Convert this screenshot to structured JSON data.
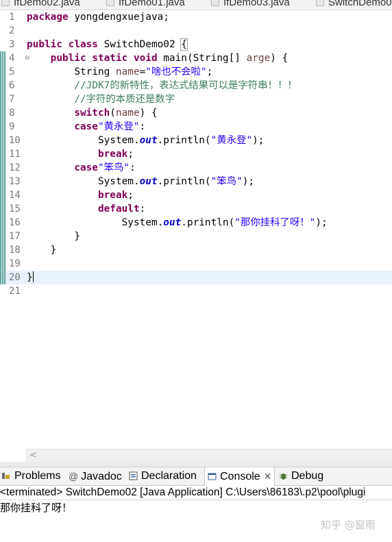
{
  "editor_tabs": [
    "IfDemo02.java",
    "IfDemo01.java",
    "IfDemo03.java",
    "SwitchDemo0"
  ],
  "code": {
    "line_numbers": [
      "1",
      "2",
      "3",
      "4",
      "5",
      "6",
      "7",
      "8",
      "9",
      "10",
      "11",
      "12",
      "13",
      "14",
      "15",
      "16",
      "17",
      "18",
      "19",
      "20",
      "21"
    ],
    "l1": {
      "kw": "package",
      "rest": " yongdengxuejava;"
    },
    "l3": {
      "kw1": "public",
      "kw2": "class",
      "name": " SwitchDemo02 ",
      "brace": "{"
    },
    "l4": {
      "kw1": "public",
      "kw2": "static",
      "kw3": "void",
      "sig1": " main(String[] ",
      "param": "arge",
      "sig2": ") {"
    },
    "l5": {
      "type": "String ",
      "var": "name",
      "eq": "=",
      "str": "\"啥也不会啦\"",
      "end": ";"
    },
    "l6": "//JDK7的新特性，表达式结果可以是字符串！！！",
    "l7": "//字符的本质还是数字",
    "l8": {
      "kw": "switch",
      "open": "(",
      "var": "name",
      "close": ") {"
    },
    "l9": {
      "kw": "case",
      "str": "\"黄永登\"",
      "end": ":"
    },
    "l10": {
      "pre": "System.",
      "fld": "out",
      "mid": ".println(",
      "str": "\"黄永登\"",
      "end": ");"
    },
    "l11": {
      "kw": "break",
      "end": ";"
    },
    "l12": {
      "kw": "case",
      "str": "\"笨鸟\"",
      "end": ":"
    },
    "l13": {
      "pre": "System.",
      "fld": "out",
      "mid": ".println(",
      "str": "\"笨鸟\"",
      "end": ");"
    },
    "l14": {
      "kw": "break",
      "end": ";"
    },
    "l15": {
      "kw": "default",
      "end": ":"
    },
    "l16": {
      "pre": "System.",
      "fld": "out",
      "mid": ".println(",
      "str": "\"那你挂科了呀！\"",
      "end": ");"
    },
    "l17": "}",
    "l18": "}",
    "l20": "}"
  },
  "views": {
    "problems": "Problems",
    "javadoc": "Javadoc",
    "declaration": "Declaration",
    "console": "Console",
    "debug": "Debug"
  },
  "console": {
    "status": "<terminated> SwitchDemo02 [Java Application] C:\\Users\\86183\\.p2\\pool\\plugi",
    "output": "那你挂科了呀！"
  },
  "watermark": "知乎 @窗雨",
  "colors": {
    "keyword": "#7f0055",
    "string": "#2a00ff",
    "comment": "#3f7f5f",
    "local_variable": "#6a3e3e",
    "field": "#0000c0",
    "current_line": "#e8f2fe"
  }
}
